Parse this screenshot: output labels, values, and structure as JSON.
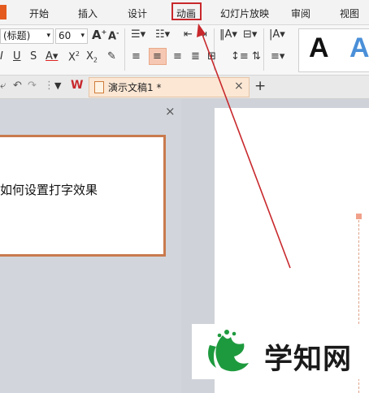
{
  "menu": {
    "tabs": [
      "开始",
      "插入",
      "设计",
      "动画",
      "幻灯片放映",
      "审阅",
      "视图"
    ],
    "highlighted_tab": "动画"
  },
  "toolbar": {
    "font_name": "(标题)",
    "font_size": "60",
    "style_gallery_letters": [
      "A",
      "A"
    ],
    "style_gallery_colors": [
      "#111111",
      "#4a8fd8"
    ]
  },
  "quick_access": {
    "app_logo": "W",
    "document_tab_title": "演示文稿1 *",
    "close_tab_symbol": "×",
    "new_tab_symbol": "+"
  },
  "left_panel": {
    "close_symbol": "×",
    "slide_text": "如何设置打字效果"
  },
  "watermark": {
    "text": "学知网"
  },
  "colors": {
    "accent_red": "#c8282c",
    "slide_border": "#c97a4e",
    "doc_tab_bg": "#fbe7d4"
  }
}
